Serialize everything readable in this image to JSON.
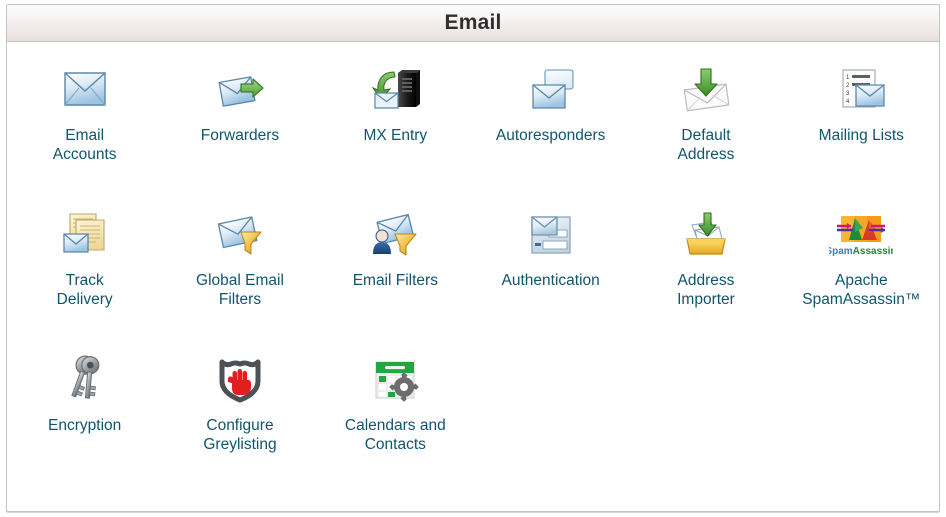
{
  "panel": {
    "title": "Email",
    "title_color": "#2f2f2f",
    "label_color": "#10556e",
    "border_color": "#c4c4c4",
    "background": "#ffffff"
  },
  "rows": [
    {
      "items": [
        {
          "label": "Email\nAccounts",
          "icon": "envelope-icon"
        },
        {
          "label": "Forwarders",
          "icon": "envelope-forward-arrow-icon"
        },
        {
          "label": "MX Entry",
          "icon": "server-tower-envelope-icon"
        },
        {
          "label": "Autoresponders",
          "icon": "envelope-speech-bubble-icon"
        },
        {
          "label": "Default\nAddress",
          "icon": "envelope-down-arrow-icon"
        },
        {
          "label": "Mailing Lists",
          "icon": "numbered-list-envelope-icon"
        }
      ]
    },
    {
      "items": [
        {
          "label": "Track\nDelivery",
          "icon": "documents-envelope-icon"
        },
        {
          "label": "Global Email\nFilters",
          "icon": "envelope-funnel-icon"
        },
        {
          "label": "Email Filters",
          "icon": "user-envelope-funnel-icon"
        },
        {
          "label": "Authentication",
          "icon": "envelope-form-card-icon"
        },
        {
          "label": "Address\nImporter",
          "icon": "inbox-tray-down-arrow-icon"
        },
        {
          "label": "Apache\nSpamAssassin™",
          "icon": "spamassassin-logo-icon"
        }
      ]
    },
    {
      "items": [
        {
          "label": "Encryption",
          "icon": "keys-icon"
        },
        {
          "label": "Configure\nGreylisting",
          "icon": "shield-red-hand-icon"
        },
        {
          "label": "Calendars and\nContacts",
          "icon": "calendar-gear-icon"
        },
        {
          "label": "",
          "icon": ""
        },
        {
          "label": "",
          "icon": ""
        },
        {
          "label": "",
          "icon": ""
        }
      ]
    }
  ]
}
